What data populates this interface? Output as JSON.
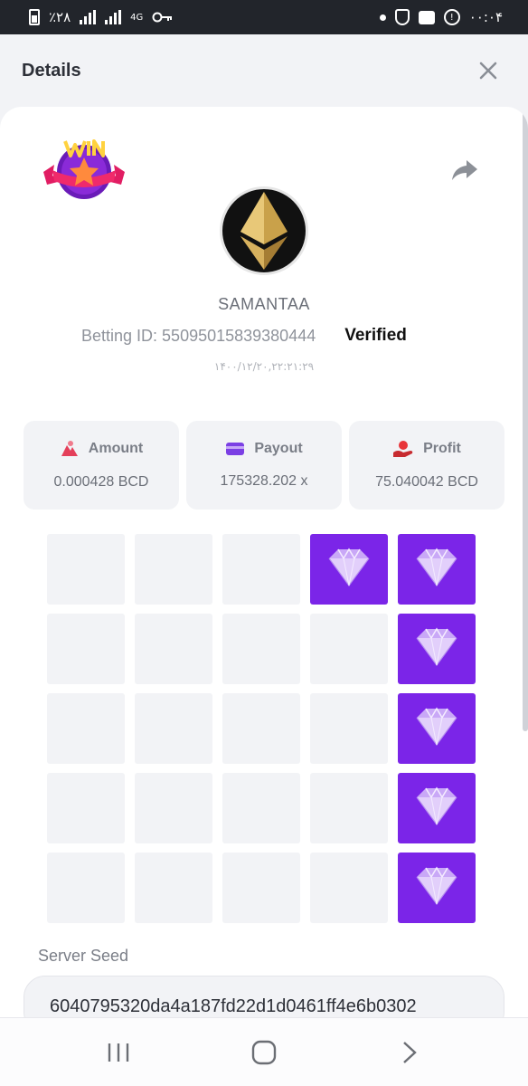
{
  "status_bar": {
    "battery_text": "٪۲۸",
    "network": "4G",
    "time": "۰۰:۰۴"
  },
  "header": {
    "title": "Details"
  },
  "bet": {
    "username": "SAMANTAA",
    "betting_id": "Betting ID: 55095015839380444",
    "verified_label": "Verified",
    "date": "۱۴۰۰/۱۲/۲۰,۲۲:۲۱:۲۹"
  },
  "stats": [
    {
      "label": "Amount",
      "value": "0.000428 BCD",
      "icon": "amount-icon"
    },
    {
      "label": "Payout",
      "value": "175328.202 x",
      "icon": "card-icon"
    },
    {
      "label": "Profit",
      "value": "75.040042 BCD",
      "icon": "profit-hand-icon"
    }
  ],
  "board": {
    "rows": 5,
    "cols": 5,
    "gem_positions": [
      [
        0,
        3
      ],
      [
        0,
        4
      ],
      [
        1,
        4
      ],
      [
        2,
        4
      ],
      [
        3,
        4
      ],
      [
        4,
        4
      ]
    ],
    "gem_color": "#7b25e8",
    "empty_color": "#f2f3f6"
  },
  "server_seed": {
    "label": "Server Seed",
    "value": "6040795320da4a187fd22d1d0461ff4e6b0302"
  },
  "colors": {
    "accent": "#7b25e8",
    "amount_icon": "#e43f5a",
    "payout_icon": "#7b3fe4",
    "profit_icon": "#e8353a"
  }
}
